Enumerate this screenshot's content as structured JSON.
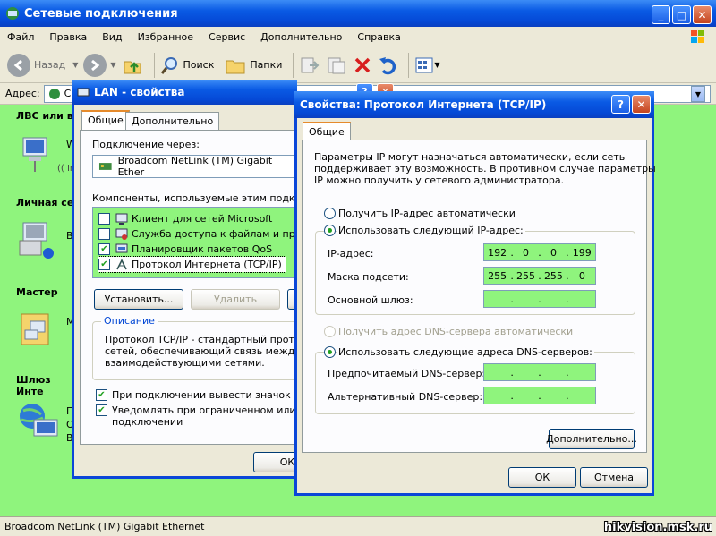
{
  "explorer": {
    "title": "Сетевые подключения",
    "menu": [
      "Файл",
      "Правка",
      "Вид",
      "Избранное",
      "Сервис",
      "Дополнительно",
      "Справка"
    ],
    "toolbar": {
      "back": "Назад",
      "search": "Поиск",
      "folders": "Папки"
    },
    "address_label": "Адрес:",
    "address_value": "Се",
    "left_pane": {
      "section_lan": "ЛВС или в",
      "lan_item_line1": "W",
      "lan_item_line2": "(( In",
      "section_personal": "Личная сет",
      "personal_item": "B",
      "section_wizard": "Мастер",
      "wizard_item": "M",
      "section_gateway": "Шлюз Инте",
      "gateway_item_line1": "П",
      "gateway_item_line2": "О",
      "gateway_item_line3": "В"
    },
    "status_text": "Broadcom NetLink (TM) Gigabit Ethernet",
    "watermark": "hikvision.msk.ru"
  },
  "lan_dialog": {
    "title": "LAN - свойства",
    "tabs": [
      "Общие",
      "Дополнительно"
    ],
    "connect_via_label": "Подключение через:",
    "adapter": "Broadcom NetLink (TM) Gigabit Ether",
    "components_label": "Компоненты, используемые этим подключе",
    "components": [
      {
        "label": "Клиент для сетей Microsoft",
        "checked": false
      },
      {
        "label": "Служба доступа к файлам и принте",
        "checked": false
      },
      {
        "label": "Планировщик пакетов QoS",
        "checked": true
      },
      {
        "label": "Протокол Интернета (TCP/IP)",
        "checked": true
      }
    ],
    "install_button": "Установить...",
    "remove_button": "Удалить",
    "description_title": "Описание",
    "description_text": "Протокол TCP/IP - стандартный протокол сетей, обеспечивающий связь между раз взаимодействующими сетями.",
    "description_lines": [
      "Протокол TCP/IP - стандартный протокол",
      "сетей, обеспечивающий связь между раз",
      "взаимодействующими сетями."
    ],
    "show_icon_label": "При подключении вывести значок в обла",
    "notify_label_line1": "Уведомлять при ограниченном или отсу",
    "notify_label_line2": "подключении",
    "ok_button": "ОК"
  },
  "tcpip_dialog": {
    "title": "Свойства: Протокол Интернета (TCP/IP)",
    "tab": "Общие",
    "intro_lines": [
      "Параметры IP могут назначаться автоматически, если сеть",
      "поддерживает эту возможность. В противном случае параметры",
      "IP можно получить у сетевого администратора."
    ],
    "auto_ip_label": "Получить IP-адрес автоматически",
    "manual_ip_label": "Использовать следующий IP-адрес:",
    "ip_label": "IP-адрес:",
    "ip_value": [
      "192",
      "0",
      "0",
      "199"
    ],
    "mask_label": "Маска подсети:",
    "mask_value": [
      "255",
      "255",
      "255",
      "0"
    ],
    "gateway_label": "Основной шлюз:",
    "gateway_value": [
      "",
      "",
      "",
      ""
    ],
    "auto_dns_label": "Получить адрес DNS-сервера автоматически",
    "manual_dns_label": "Использовать следующие адреса DNS-серверов:",
    "preferred_dns_label": "Предпочитаемый DNS-сервер:",
    "alternate_dns_label": "Альтернативный DNS-сервер:",
    "advanced_button": "Дополнительно...",
    "ok_button": "ОК",
    "cancel_button": "Отмена",
    "ip_mode": "manual",
    "dns_mode": "manual"
  }
}
